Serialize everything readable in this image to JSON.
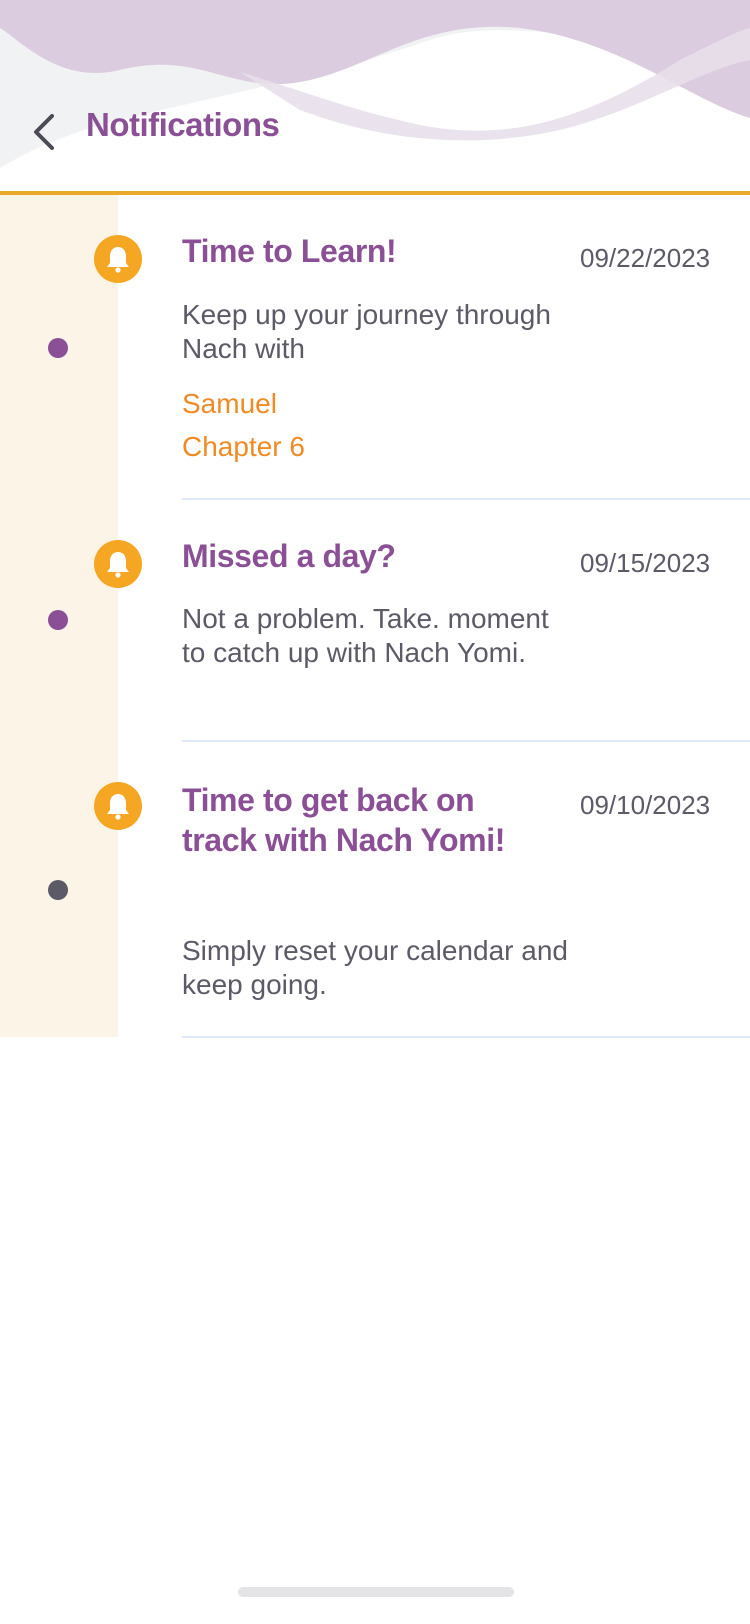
{
  "header": {
    "title": "Notifications",
    "accent_color": "#8a4f95",
    "rule_color": "#eaa92a"
  },
  "notifications": [
    {
      "title": "Time to Learn!",
      "date": "09/22/2023",
      "body": "Keep up your journey through Nach with",
      "book": "Samuel",
      "chapter": "Chapter 6",
      "dot_color": "#8a4f95",
      "icon": "bell-icon"
    },
    {
      "title": "Missed a day?",
      "date": "09/15/2023",
      "body": "Not a problem. Take. moment to catch up with Nach Yomi.",
      "dot_color": "#8a4f95",
      "icon": "bell-icon"
    },
    {
      "title": "Time to get back on track with Nach Yomi!",
      "date": "09/10/2023",
      "body": "Simply reset your calendar and keep going.",
      "dot_color": "#5c5a66",
      "icon": "bell-icon"
    }
  ]
}
